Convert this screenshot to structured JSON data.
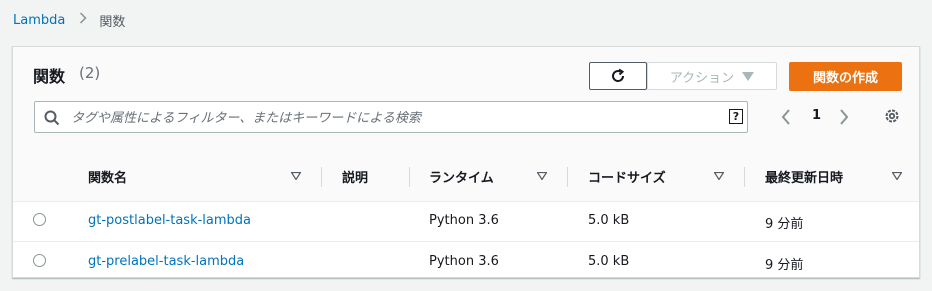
{
  "breadcrumb": {
    "root": "Lambda",
    "current": "関数"
  },
  "panel": {
    "title": "関数",
    "count": "(2)",
    "actions_label": "アクション",
    "create_label": "関数の作成",
    "search_placeholder": "タグや属性によるフィルター、またはキーワードによる検索",
    "help_glyph": "?",
    "page_number": "1"
  },
  "table": {
    "columns": [
      "関数名",
      "説明",
      "ランタイム",
      "コードサイズ",
      "最終更新日時"
    ],
    "rows": [
      {
        "name": "gt-postlabel-task-lambda",
        "description": "",
        "runtime": "Python 3.6",
        "code_size": "5.0 kB",
        "last_modified": "9 分前"
      },
      {
        "name": "gt-prelabel-task-lambda",
        "description": "",
        "runtime": "Python 3.6",
        "code_size": "5.0 kB",
        "last_modified": "9 分前"
      }
    ]
  },
  "colors": {
    "link": "#0073bb",
    "primary_button": "#ec7211",
    "background": "#f2f3f3"
  },
  "icons": [
    "chevron-right-icon",
    "refresh-icon",
    "caret-down-icon",
    "search-icon",
    "help-icon",
    "chevron-left-icon",
    "gear-icon",
    "sort-icon"
  ]
}
